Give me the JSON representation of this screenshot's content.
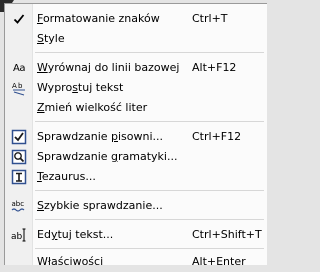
{
  "menu": {
    "items": [
      {
        "pre": "",
        "ul": "F",
        "post": "ormatowanie znaków",
        "shortcut": "Ctrl+T",
        "icon": "checkmark-icon"
      },
      {
        "pre": "",
        "ul": "S",
        "post": "tyle",
        "shortcut": "",
        "icon": ""
      },
      {
        "pre": "",
        "ul": "W",
        "post": "yrównaj do linii bazowej",
        "shortcut": "Alt+F12",
        "icon": "align-baseline-icon"
      },
      {
        "pre": "Wypro",
        "ul": "s",
        "post": "tuj tekst",
        "shortcut": "",
        "icon": "straighten-text-icon"
      },
      {
        "pre": "",
        "ul": "Z",
        "post": "mień wielkość liter",
        "shortcut": "",
        "icon": ""
      },
      {
        "pre": "Sprawdzanie ",
        "ul": "p",
        "post": "isowni...",
        "shortcut": "Ctrl+F12",
        "icon": "spell-check-icon"
      },
      {
        "pre": "Sprawdzanie ",
        "ul": "g",
        "post": "ramatyki...",
        "shortcut": "",
        "icon": "grammar-check-icon"
      },
      {
        "pre": "",
        "ul": "T",
        "post": "ezaurus...",
        "shortcut": "",
        "icon": "thesaurus-icon"
      },
      {
        "pre": "",
        "ul": "S",
        "post": "zybkie sprawdzanie...",
        "shortcut": "",
        "icon": "quick-correct-icon"
      },
      {
        "pre": "Ed",
        "ul": "y",
        "post": "tuj tekst...",
        "shortcut": "Ctrl+Shift+T",
        "icon": "edit-text-icon"
      },
      {
        "pre": "Właściwości",
        "ul": "",
        "post": "",
        "shortcut": "Alt+Enter",
        "icon": ""
      }
    ],
    "icon_text": {
      "baseline": "Aa",
      "quick": "abc"
    },
    "colors": {
      "background": "#fbfbfb",
      "gutter": "#f0f0f0",
      "separator": "#d7d7d7",
      "icon_blue": "#2f4f8f"
    }
  }
}
